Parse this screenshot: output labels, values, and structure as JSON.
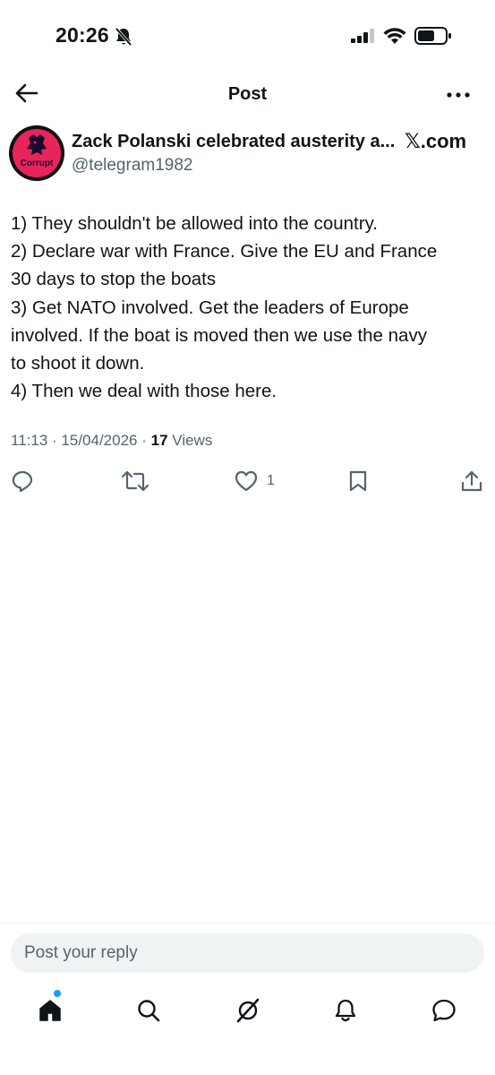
{
  "status_bar": {
    "time": "20:26",
    "icons": [
      "bell-slash-icon",
      "cellular-signal-icon",
      "wifi-icon",
      "battery-icon"
    ]
  },
  "header": {
    "title": "Post",
    "back_icon": "arrow-left-icon",
    "more_icon": "ellipsis-icon"
  },
  "post": {
    "author": {
      "name": "Zack Polanski celebrated austerity a...",
      "handle": "@telegram1982",
      "avatar_text": "Corrupt",
      "badge": "𝕏.com"
    },
    "lines": [
      "1) They shouldn't be allowed into the country.",
      "2) Declare war with France. Give the EU and France",
      "30 days to stop the boats",
      "3) Get NATO involved.  Get the leaders of Europe",
      "involved. If the boat is moved then we use the navy",
      "to shoot it down.",
      "4) Then we deal with those here."
    ],
    "meta": {
      "time": "11:13",
      "date": "15/04/2026",
      "views_count": "17",
      "views_label": "Views"
    },
    "actions": {
      "reply_icon": "reply-icon",
      "repost_icon": "repost-icon",
      "like_icon": "heart-icon",
      "like_count": "1",
      "bookmark_icon": "bookmark-icon",
      "share_icon": "share-icon"
    }
  },
  "reply": {
    "placeholder": "Post your reply"
  },
  "bottom_nav": [
    {
      "name": "home",
      "icon": "home-icon"
    },
    {
      "name": "search",
      "icon": "search-icon"
    },
    {
      "name": "grok",
      "icon": "grok-icon"
    },
    {
      "name": "notifications",
      "icon": "bell-icon"
    },
    {
      "name": "messages",
      "icon": "message-icon"
    }
  ],
  "colors": {
    "accent": "#1d9bf0",
    "text": "#0f1419",
    "secondary": "#536471",
    "avatar_ring": "#e8245c"
  }
}
